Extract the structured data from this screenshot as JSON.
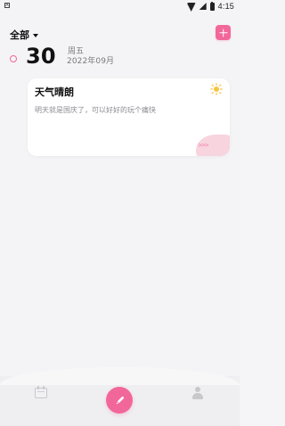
{
  "status_bar": {
    "time": "4:15",
    "left_indicator": "A",
    "icons": [
      "wifi-icon",
      "signal-icon",
      "battery-icon"
    ]
  },
  "header": {
    "filter_label": "全部",
    "add_icon": "plus-icon"
  },
  "date": {
    "day": "30",
    "weekday": "周五",
    "year_month": "2022年09月"
  },
  "entry": {
    "title": "天气晴朗",
    "body": "明天就是国庆了，可以好好的玩个痛快",
    "weather_icon": "sun-icon",
    "more": ">>>"
  },
  "bottom_nav": {
    "items": [
      {
        "name": "calendar",
        "icon": "calendar-icon"
      },
      {
        "name": "write",
        "icon": "pencil-icon"
      },
      {
        "name": "profile",
        "icon": "profile-icon"
      }
    ]
  },
  "colors": {
    "accent": "#f2679a",
    "background": "#f4f4f6",
    "card": "#ffffff",
    "muted": "#8b8b90",
    "sun": "#f5c542"
  }
}
